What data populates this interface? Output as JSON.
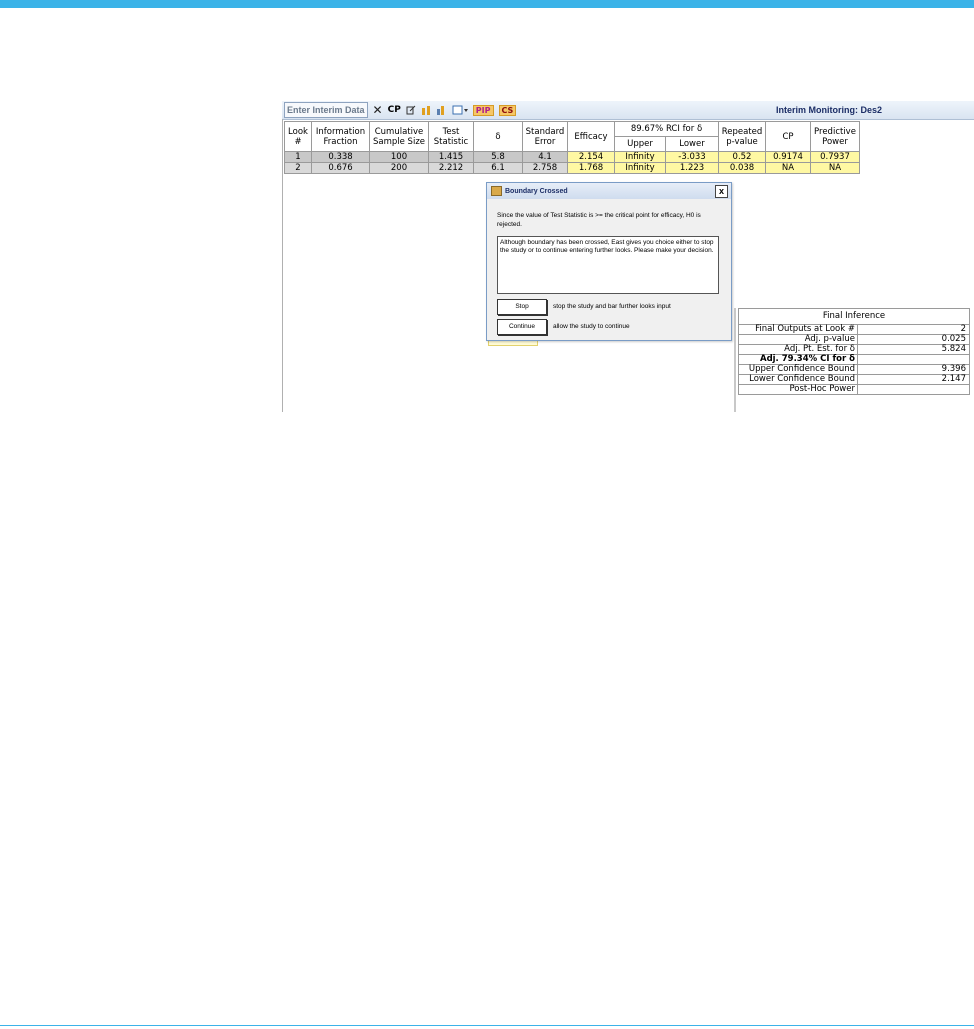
{
  "toolbar": {
    "enter_label": "Enter Interim Data",
    "close_glyph": "✕",
    "cp_label": "CP",
    "pip_label": "PIP",
    "cs_label": "CS",
    "title": "Interim Monitoring: Des2"
  },
  "table": {
    "headers": {
      "look": [
        "Look",
        "#"
      ],
      "info": [
        "Information",
        "Fraction"
      ],
      "cum": [
        "Cumulative",
        "Sample Size"
      ],
      "test": [
        "Test",
        "Statistic"
      ],
      "delta": "δ",
      "se": [
        "Standard",
        "Error"
      ],
      "efficacy": "Efficacy",
      "rci": "89.67% RCI for δ",
      "upper": "Upper",
      "lower": "Lower",
      "rep": [
        "Repeated",
        "p-value"
      ],
      "cp": "CP",
      "pp": [
        "Predictive",
        "Power"
      ]
    },
    "rows": [
      {
        "look": "1",
        "info": "0.338",
        "cum": "100",
        "test": "1.415",
        "delta": "5.8",
        "se": "4.1",
        "eff": "2.154",
        "upper": "Infinity",
        "lower": "-3.033",
        "rep": "0.52",
        "cp": "0.9174",
        "pp": "0.7937"
      },
      {
        "look": "2",
        "info": "0.676",
        "cum": "200",
        "test": "2.212",
        "delta": "6.1",
        "se": "2.758",
        "eff": "1.768",
        "upper": "Infinity",
        "lower": "1.223",
        "rep": "0.038",
        "cp": "NA",
        "pp": "NA"
      }
    ]
  },
  "dialog": {
    "title": "Boundary Crossed",
    "close": "x",
    "message": "Since the value of Test Statistic is >= the critical point for efficacy, H0 is rejected.",
    "box_text": "Although boundary has been crossed, East gives you choice either to stop the study or to continue entering further looks. Please make your decision.",
    "stop_label": "Stop",
    "stop_desc": "stop the study and bar further looks input",
    "continue_label": "Continue",
    "continue_desc": "allow the study to continue"
  },
  "final_inference": {
    "title": "Final Inference",
    "rows": [
      {
        "label": "Final Outputs at Look #",
        "value": "2"
      },
      {
        "label": "Adj. p-value",
        "value": "0.025"
      },
      {
        "label": "Adj. Pt. Est. for δ",
        "value": "5.824"
      },
      {
        "label": "Adj. 79.34% CI for δ",
        "value": ""
      },
      {
        "label": "Upper Confidence Bound",
        "value": "9.396"
      },
      {
        "label": "Lower Confidence Bound",
        "value": "2.147"
      },
      {
        "label": "Post-Hoc Power",
        "value": ""
      }
    ]
  },
  "colors": {
    "accent": "#3bb3e8",
    "highlight": "#fff8a3",
    "title": "#1c2e66"
  }
}
